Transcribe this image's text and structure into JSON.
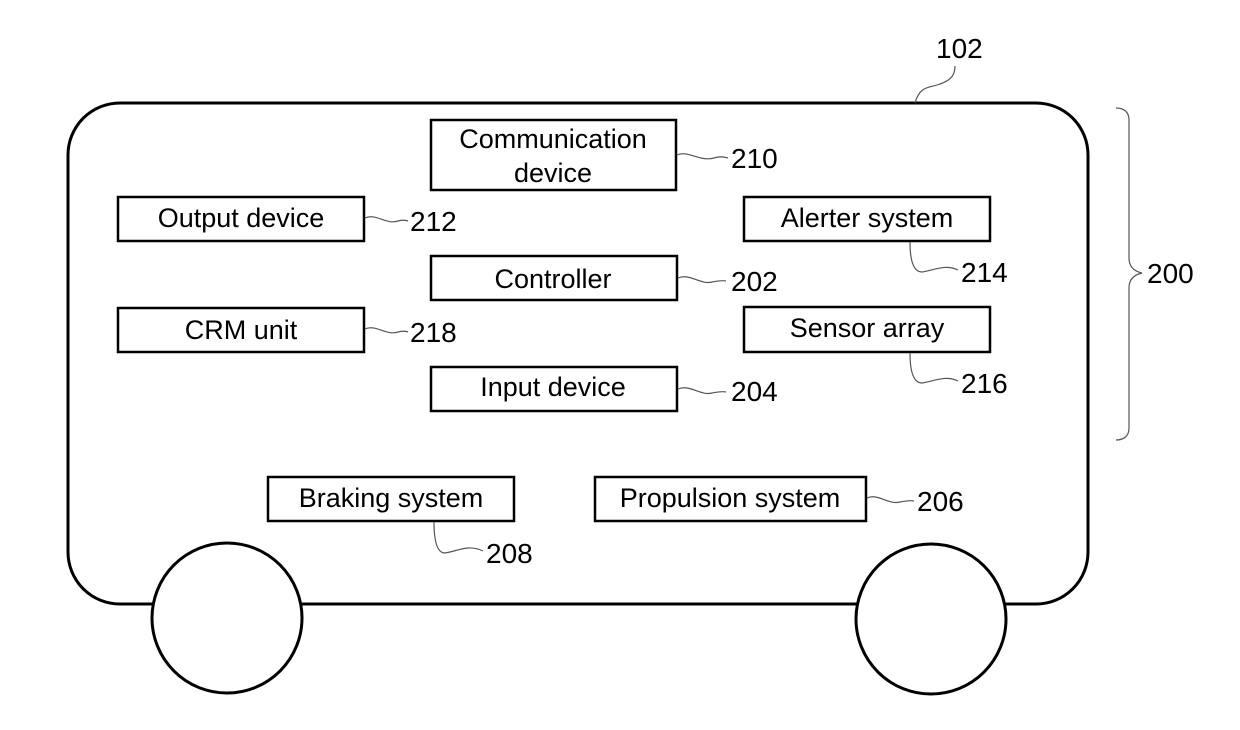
{
  "figure": {
    "vehicle": {
      "ref": "102"
    },
    "group": {
      "ref": "200"
    },
    "components": [
      {
        "id": "communication-device",
        "lines": [
          "Communication",
          "device"
        ],
        "ref": "210"
      },
      {
        "id": "output-device",
        "lines": [
          "Output device"
        ],
        "ref": "212"
      },
      {
        "id": "alerter-system",
        "lines": [
          "Alerter system"
        ],
        "ref": "214"
      },
      {
        "id": "controller",
        "lines": [
          "Controller"
        ],
        "ref": "202"
      },
      {
        "id": "crm-unit",
        "lines": [
          "CRM unit"
        ],
        "ref": "218"
      },
      {
        "id": "sensor-array",
        "lines": [
          "Sensor array"
        ],
        "ref": "216"
      },
      {
        "id": "input-device",
        "lines": [
          "Input device"
        ],
        "ref": "204"
      },
      {
        "id": "braking-system",
        "lines": [
          "Braking system"
        ],
        "ref": "208"
      },
      {
        "id": "propulsion-system",
        "lines": [
          "Propulsion system"
        ],
        "ref": "206"
      }
    ]
  }
}
